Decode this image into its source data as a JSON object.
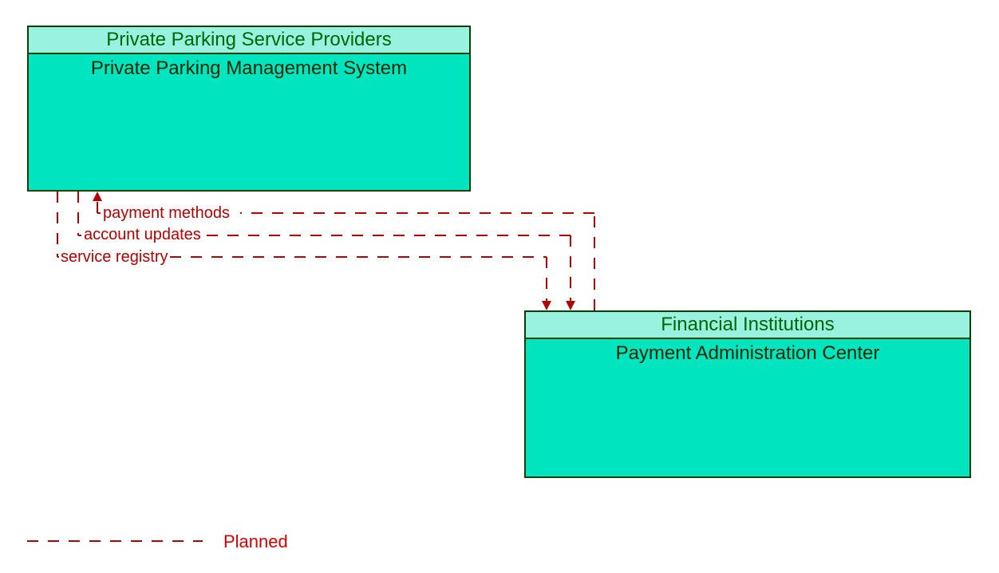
{
  "box1": {
    "owner": "Private Parking Service Providers",
    "system": "Private Parking Management System"
  },
  "box2": {
    "owner": "Financial Institutions",
    "system": "Payment Administration Center"
  },
  "flows": {
    "payment_methods": "payment methods",
    "account_updates": "account updates",
    "service_registry": "service registry"
  },
  "legend": {
    "planned": "Planned"
  }
}
